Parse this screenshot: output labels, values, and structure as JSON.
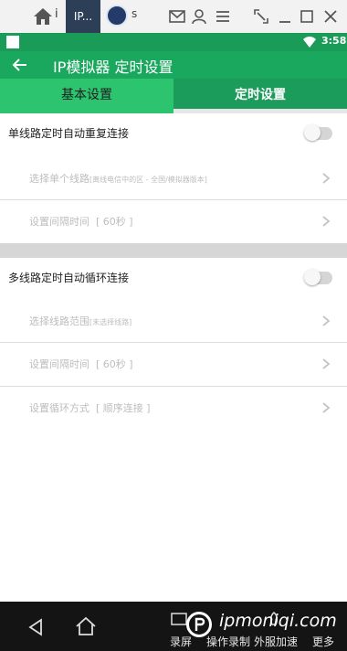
{
  "titlebar": {
    "tab1_char": "i",
    "tab_active_label": "IP...",
    "tab3_char": "s"
  },
  "status_bar": {
    "time": "3:58"
  },
  "app_bar": {
    "title": "IP模拟器 定时设置"
  },
  "tabs": [
    {
      "label": "基本设置",
      "selected": false
    },
    {
      "label": "定时设置",
      "selected": true
    }
  ],
  "single_line": {
    "header": "单线路定时自动重复连接",
    "toggle_on": false,
    "select_line": {
      "label": "选择单个线路",
      "detail": "[离线电信中的区 - 全国/模拟器版本]"
    },
    "interval": {
      "label": "设置间隔时间",
      "value": "[ 60秒 ]"
    }
  },
  "multi_line": {
    "header": "多线路定时自动循环连接",
    "toggle_on": false,
    "select_range": {
      "label": "选择线路范围",
      "detail": "[未选择线路]"
    },
    "interval": {
      "label": "设置间隔时间",
      "value": "[ 60秒 ]"
    },
    "cycle_mode": {
      "label": "设置循环方式",
      "value": "[ 顺序连接 ]"
    }
  },
  "bottom_bar": {
    "labels": [
      "录屏",
      "操作录制",
      "外服加速",
      "更多"
    ],
    "watermark": "ipmoniqi.com"
  },
  "colors": {
    "status_green": "#1b9b58",
    "appbar_green": "#1aa85f",
    "tab_light_green": "#2cc46f",
    "tab_dark_green": "#1b9c5b"
  }
}
